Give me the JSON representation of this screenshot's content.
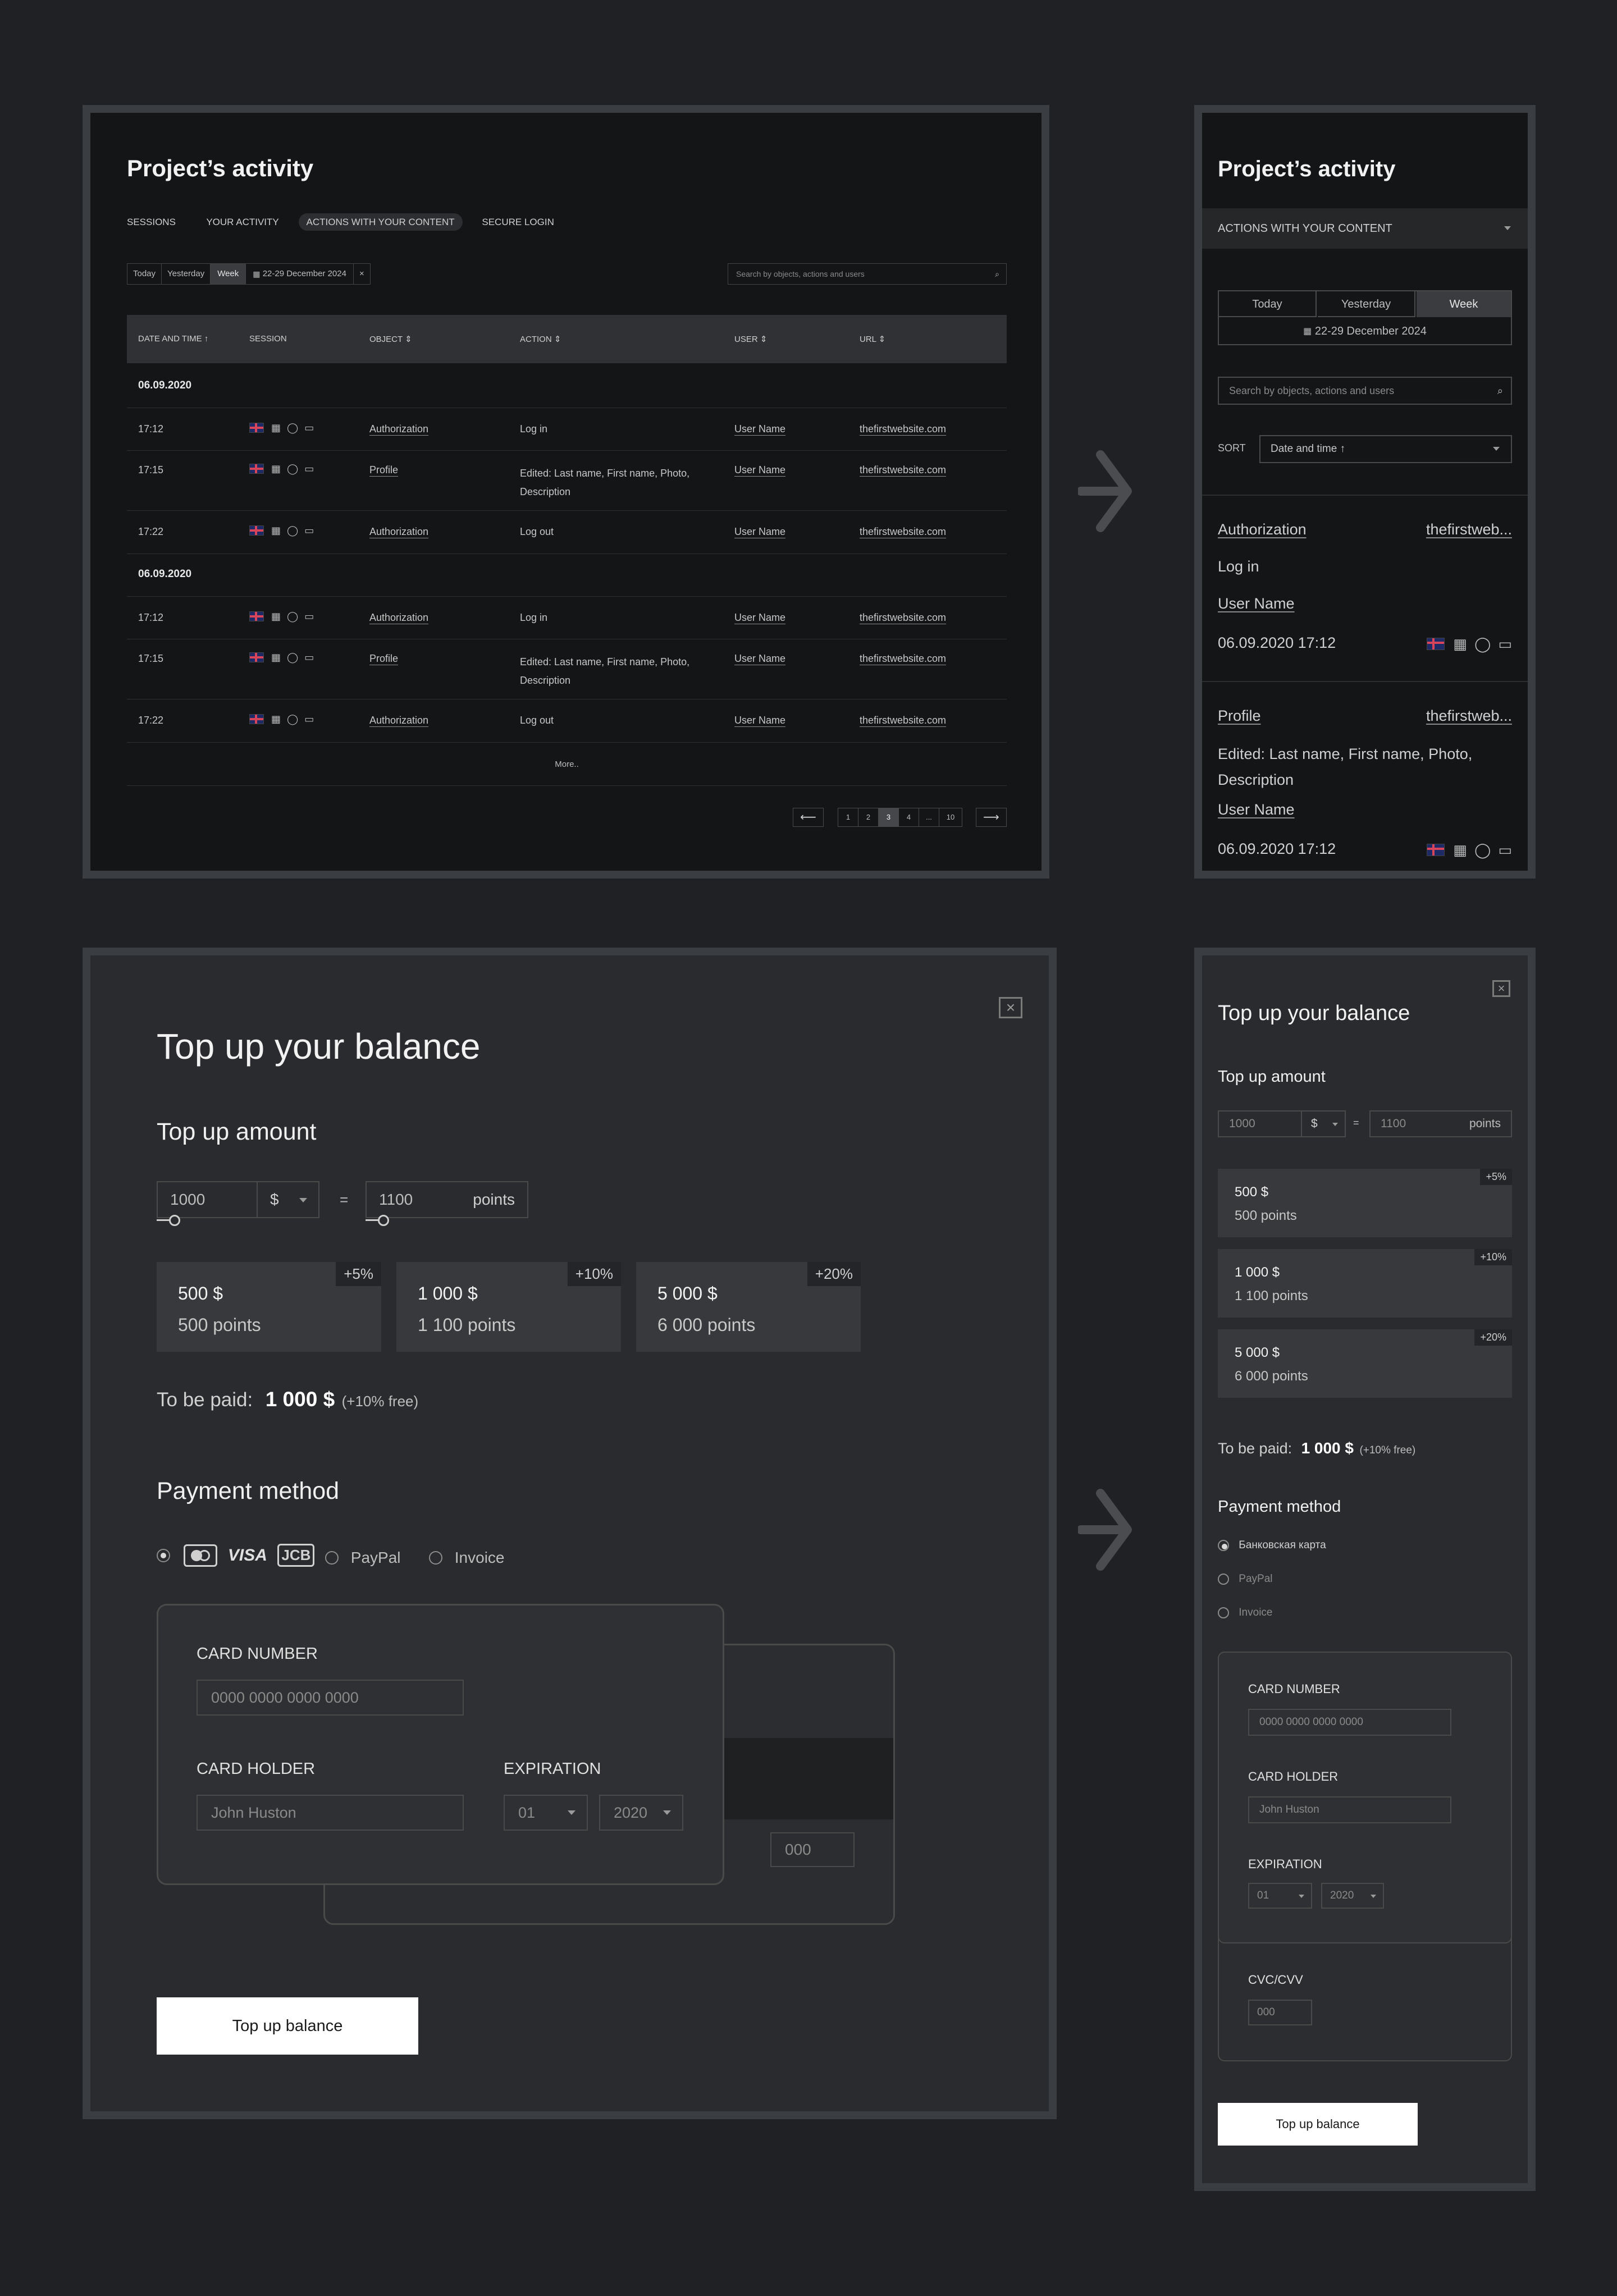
{
  "activity_desktop": {
    "title": "Project’s activity",
    "tabs": [
      "SESSIONS",
      "YOUR ACTIVITY",
      "ACTIONS WITH YOUR CONTENT",
      "SECURE LOGIN"
    ],
    "filters": {
      "today": "Today",
      "yesterday": "Yesterday",
      "week": "Week",
      "date_range": "22-29 December 2024",
      "clear": "×"
    },
    "search_placeholder": "Search by objects, actions and users",
    "columns": {
      "date": "DATE AND TIME",
      "session": "SESSION",
      "object": "OBJECT",
      "action": "ACTION",
      "user": "USER",
      "url": "URL"
    },
    "groups": [
      {
        "date": "06.09.2020",
        "rows": [
          {
            "time": "17:12",
            "object": "Authorization",
            "action": "Log in",
            "user": "User Name",
            "url": "thefirstwebsite.com"
          },
          {
            "time": "17:15",
            "object": "Profile",
            "action": "Edited: Last name, First name, Photo, Description",
            "user": "User Name",
            "url": "thefirstwebsite.com"
          },
          {
            "time": "17:22",
            "object": "Authorization",
            "action": "Log out",
            "user": "User Name",
            "url": "thefirstwebsite.com"
          }
        ]
      },
      {
        "date": "06.09.2020",
        "rows": [
          {
            "time": "17:12",
            "object": "Authorization",
            "action": "Log in",
            "user": "User Name",
            "url": "thefirstwebsite.com"
          },
          {
            "time": "17:15",
            "object": "Profile",
            "action": "Edited: Last name, First name, Photo, Description",
            "user": "User Name",
            "url": "thefirstwebsite.com"
          },
          {
            "time": "17:22",
            "object": "Authorization",
            "action": "Log out",
            "user": "User Name",
            "url": "thefirstwebsite.com"
          }
        ]
      }
    ],
    "more": "More..",
    "pagination": {
      "prev": "⟵",
      "next": "⟶",
      "pages": [
        "1",
        "2",
        "3",
        "4",
        "...",
        "10"
      ],
      "active_page": "3"
    }
  },
  "activity_mobile": {
    "title": "Project’s activity",
    "dropdown": "ACTIONS WITH YOUR CONTENT",
    "filters": {
      "today": "Today",
      "yesterday": "Yesterday",
      "week": "Week",
      "date_range": "22-29 December 2024"
    },
    "search_placeholder": "Search by objects, actions and users",
    "sort_label": "SORT",
    "sort_value": "Date and time ↑",
    "cards": [
      {
        "object": "Authorization",
        "url": "thefirstweb...",
        "action": "Log in",
        "user": "User Name",
        "datetime": "06.09.2020 17:12"
      },
      {
        "object": "Profile",
        "url": "thefirstweb...",
        "action": "Edited: Last name, First name, Photo, Description",
        "user": "User Name",
        "datetime": "06.09.2020 17:12"
      }
    ]
  },
  "topup_desktop": {
    "close": "×",
    "title": "Top up your balance",
    "amount_heading": "Top up amount",
    "amount_value": "1000",
    "currency": "$",
    "equals": "=",
    "points_value": "1100",
    "points_label": "points",
    "slider_level_percent": 0,
    "packages": [
      {
        "bonus": "+5%",
        "price": "500 $",
        "points": "500 points"
      },
      {
        "bonus": "+10%",
        "price": "1 000 $",
        "points": "1 100 points"
      },
      {
        "bonus": "+20%",
        "price": "5 000 $",
        "points": "6 000 points"
      }
    ],
    "to_be_paid_label": "To be paid:",
    "to_be_paid_amount": "1 000 $",
    "to_be_paid_note": "(+10% free)",
    "payment_heading": "Payment method",
    "payment_options": {
      "paypal": "PayPal",
      "invoice": "Invoice"
    },
    "card_logos": {
      "visa": "VISA",
      "jcb": "JCB"
    },
    "card_number_label": "CARD NUMBER",
    "card_number_placeholder": "0000 0000 0000 0000",
    "card_holder_label": "CARD HOLDER",
    "card_holder_placeholder": "John Huston",
    "expiration_label": "EXPIRATION",
    "exp_month": "01",
    "exp_year": "2020",
    "cvc_placeholder": "000",
    "submit": "Top up balance"
  },
  "topup_mobile": {
    "close": "×",
    "title": "Top up your balance",
    "amount_heading": "Top up amount",
    "amount_value": "1000",
    "currency": "$",
    "equals": "=",
    "points_value": "1100",
    "points_label": "points",
    "packages": [
      {
        "bonus": "+5%",
        "price": "500 $",
        "points": "500 points"
      },
      {
        "bonus": "+10%",
        "price": "1 000 $",
        "points": "1 100 points"
      },
      {
        "bonus": "+20%",
        "price": "5 000 $",
        "points": "6 000 points"
      }
    ],
    "to_be_paid_label": "To be paid:",
    "to_be_paid_amount": "1 000 $",
    "to_be_paid_note": "(+10% free)",
    "payment_heading": "Payment method",
    "payment_options": [
      "Банковская карта",
      "PayPal",
      "Invoice"
    ],
    "card_number_label": "CARD NUMBER",
    "card_number_placeholder": "0000 0000 0000 0000",
    "card_holder_label": "CARD HOLDER",
    "card_holder_placeholder": "John Huston",
    "expiration_label": "EXPIRATION",
    "exp_month": "01",
    "exp_year": "2020",
    "cvc_label": "CVC/CVV",
    "cvc_placeholder": "000",
    "submit": "Top up balance"
  },
  "colors": {
    "page_bg": "#1f2124",
    "panel_dark": "#131517",
    "panel_mid": "#2c2d30",
    "frame": "#3a3d41",
    "accent": "#ffffff"
  },
  "icons": [
    "arrow-right-icon",
    "flag-uk-icon",
    "windows-icon",
    "opera-icon",
    "desktop-icon",
    "calendar-icon",
    "search-icon",
    "close-icon",
    "chevron-down-icon",
    "mastercard-icon"
  ]
}
